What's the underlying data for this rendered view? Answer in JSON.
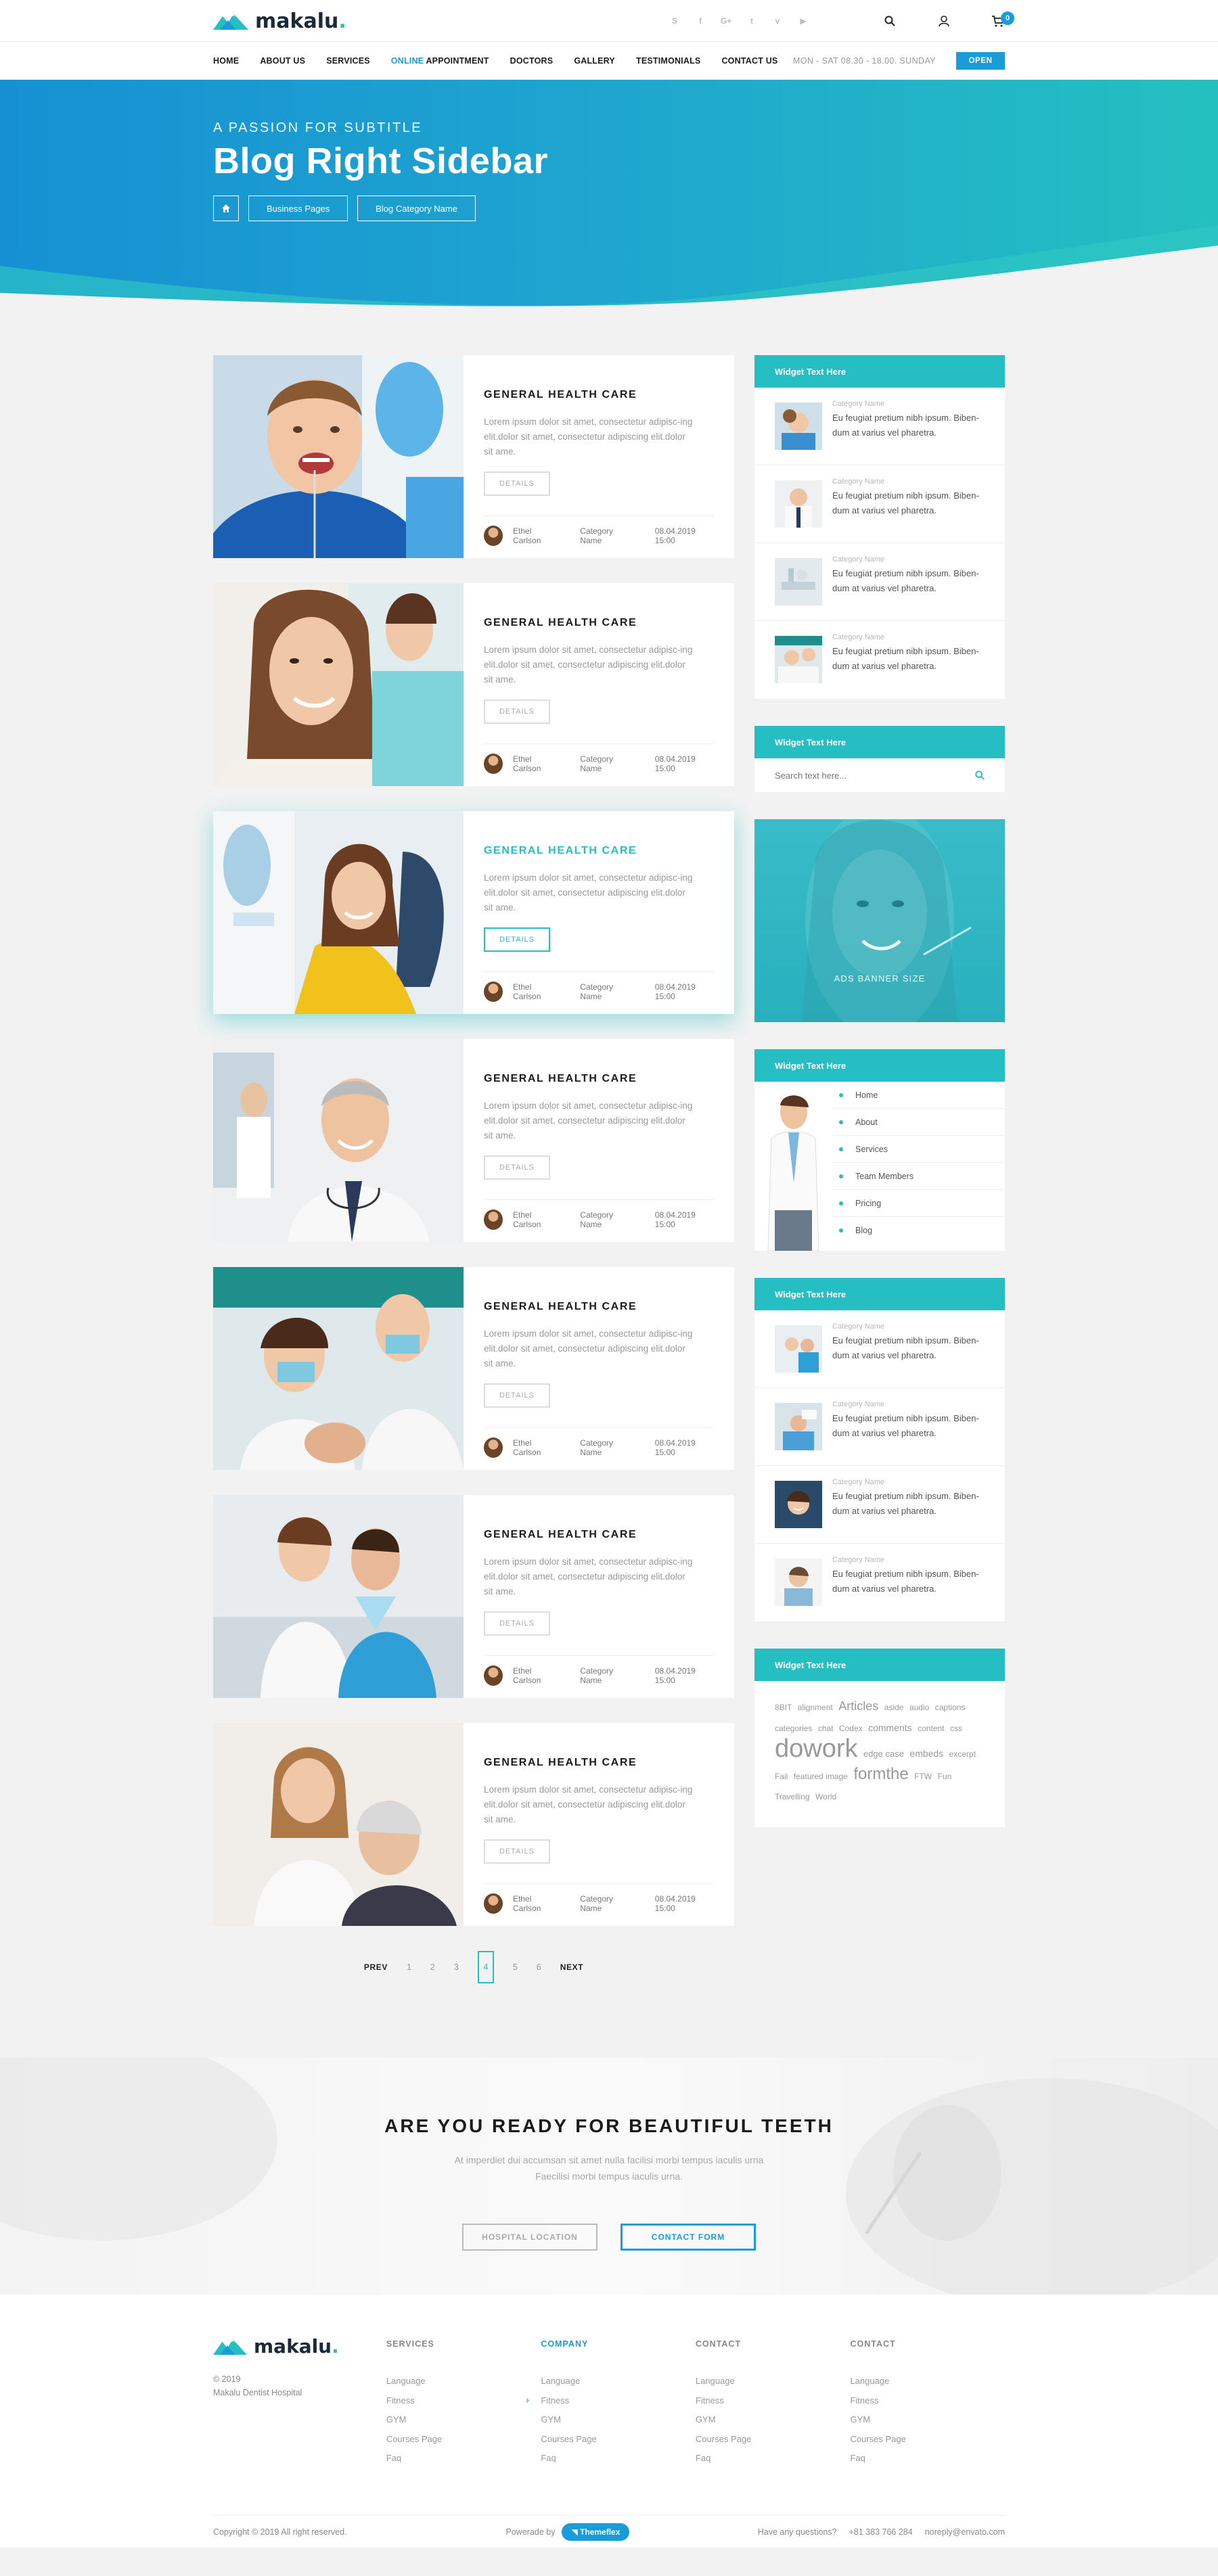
{
  "brand": {
    "name": "makalu",
    "dot": "."
  },
  "header": {
    "nav": [
      {
        "label": "HOME"
      },
      {
        "label": "ABOUT US"
      },
      {
        "label": "SERVICES"
      },
      {
        "label_hl": "ONLINE",
        "label": " APPOINTMENT"
      },
      {
        "label": "DOCTORS"
      },
      {
        "label": "GALLERY"
      },
      {
        "label": "TESTIMONIALS"
      },
      {
        "label": "CONTACT US"
      }
    ],
    "hours": "MON - SAT 08.30 - 18.00. SUNDAY",
    "open": "OPEN",
    "cart_count": "0"
  },
  "hero": {
    "subtitle": "A PASSION FOR SUBTITLE",
    "title": "Blog Right Sidebar",
    "crumbs": [
      "Business Pages",
      "Blog Category Name"
    ]
  },
  "post": {
    "title": "GENERAL HEALTH CARE",
    "excerpt": "Lorem ipsum dolor sit amet, consectetur adipisc-ing elit.dolor sit amet, consectetur adipiscing elit.dolor sit ame.",
    "details": "DETAILS",
    "author": "Ethel Carlson",
    "category": "Category Name",
    "date": "08.04.2019 15:00"
  },
  "pagination": {
    "prev": "PREV",
    "next": "NEXT",
    "pages": [
      "1",
      "2",
      "3",
      "4",
      "5",
      "6"
    ],
    "current": "4"
  },
  "sidebar": {
    "widget_title": "Widget Text Here",
    "post_cat": "Category Name",
    "post_desc": "Eu feugiat pretium nibh ipsum. Biben-dum at varius vel pharetra.",
    "search_placeholder": "Search text here...",
    "banner": "ADS BANNER SIZE",
    "menu": [
      "Home",
      "About",
      "Services",
      "Team Members",
      "Pricing",
      "Blog"
    ],
    "tags": [
      {
        "t": "8BIT",
        "s": 12
      },
      {
        "t": "alignment",
        "s": 12
      },
      {
        "t": "Articles",
        "s": 18
      },
      {
        "t": "aside",
        "s": 12
      },
      {
        "t": "audio",
        "s": 12
      },
      {
        "t": "captions",
        "s": 12
      },
      {
        "t": "categories",
        "s": 12
      },
      {
        "t": "chat",
        "s": 12
      },
      {
        "t": "Codex",
        "s": 12
      },
      {
        "t": "comments",
        "s": 14
      },
      {
        "t": "content",
        "s": 12
      },
      {
        "t": "css",
        "s": 12
      },
      {
        "t": "dowork",
        "s": 38
      },
      {
        "t": "edge case",
        "s": 13
      },
      {
        "t": "embeds",
        "s": 14
      },
      {
        "t": "excerpt",
        "s": 12
      },
      {
        "t": "Fail",
        "s": 12
      },
      {
        "t": "featured image",
        "s": 12
      },
      {
        "t": "formthe",
        "s": 24
      },
      {
        "t": "FTW",
        "s": 12
      },
      {
        "t": "Fun",
        "s": 12
      },
      {
        "t": "Travelling",
        "s": 12
      },
      {
        "t": "World",
        "s": 12
      }
    ]
  },
  "cta": {
    "title": "ARE YOU READY FOR BEAUTIFUL TEETH",
    "text1": "At imperdiet dui accumsan sit amet nulla facilisi morbi tempus iaculis urna",
    "text2": "Faecilisi morbi tempus iaculis urna.",
    "btn1": "HOSPITAL LOCATION",
    "btn2": "CONTACT FORM"
  },
  "footer": {
    "year": "© 2019",
    "org": "Makalu Dentist Hospital",
    "columns": [
      {
        "title": "SERVICES",
        "links": [
          "Language",
          "Fitness",
          "GYM",
          "Courses Page",
          "Faq"
        ]
      },
      {
        "title": "COMPANY",
        "links": [
          "Language",
          "Fitness",
          "GYM",
          "Courses Page",
          "Faq"
        ]
      },
      {
        "title": "CONTACT",
        "links": [
          "Language",
          "Fitness",
          "GYM",
          "Courses Page",
          "Faq"
        ]
      },
      {
        "title": "CONTACT",
        "links": [
          "Language",
          "Fitness",
          "GYM",
          "Courses Page",
          "Faq"
        ]
      }
    ],
    "copyright": "Copyright © 2019 All right reserved.",
    "powered_by": "Powerade by",
    "powered_brand": "Themeflex",
    "question": "Have any questions?",
    "phone": "+81 383 766 284",
    "email": "noreply@envato.com"
  },
  "colors": {
    "accent": "#24bec3",
    "blue": "#1a9cd8"
  }
}
